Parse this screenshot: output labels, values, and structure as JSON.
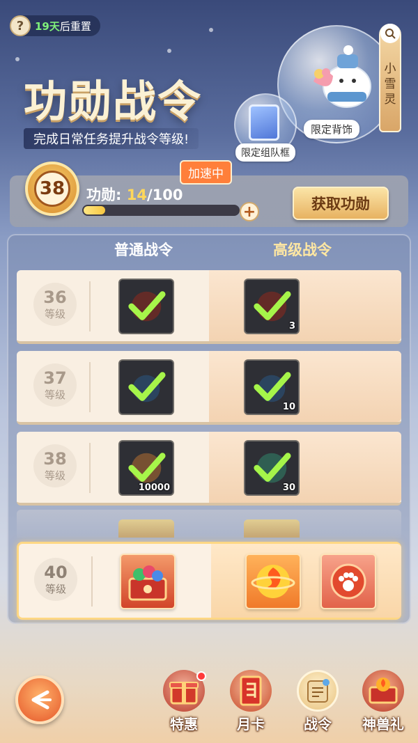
{
  "header": {
    "help_icon": "?",
    "reset_days": "19天",
    "reset_suffix": "后重置",
    "title": "功勋战令",
    "subtitle": "完成日常任务提升战令等级!",
    "side_tab_label": "小雪灵",
    "tag_backpiece": "限定背饰",
    "tag_frame": "限定组队框"
  },
  "progress": {
    "level": "38",
    "label": "功勋:",
    "current": "14",
    "total": "/100",
    "fill_fraction": 0.14,
    "speedup_badge": "加速中",
    "get_button": "获取功勋"
  },
  "columns": {
    "normal": "普通战令",
    "premium": "高级战令"
  },
  "level_word": "等级",
  "rows": [
    {
      "level": "36",
      "normal_qty": "",
      "premium_qty": "3"
    },
    {
      "level": "37",
      "normal_qty": "",
      "premium_qty": "10"
    },
    {
      "level": "38",
      "normal_qty": "10000",
      "premium_qty": "30"
    }
  ],
  "highlight_row": {
    "level": "40"
  },
  "nav": [
    {
      "label": "特惠",
      "icon": "gift-chest-icon"
    },
    {
      "label": "月卡",
      "icon": "month-card-icon"
    },
    {
      "label": "战令",
      "icon": "battle-pass-scroll-icon"
    },
    {
      "label": "神兽礼",
      "icon": "beast-gift-icon"
    }
  ],
  "colors": {
    "accent_orange": "#ff7f3a",
    "gold": "#f7c640",
    "check_green": "#a6f54a"
  }
}
